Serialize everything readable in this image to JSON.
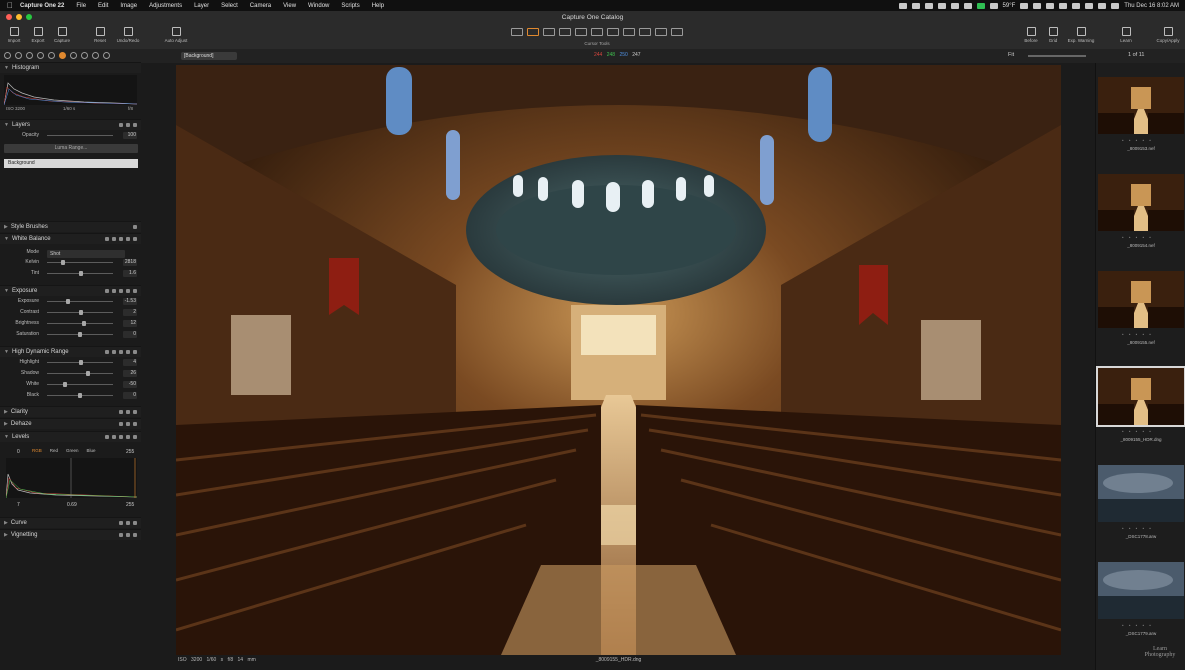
{
  "menubar": {
    "app_name": "Capture One 22",
    "items": [
      "File",
      "Edit",
      "Image",
      "Adjustments",
      "Layer",
      "Select",
      "Camera",
      "View",
      "Window",
      "Scripts",
      "Help"
    ],
    "temperature": "59°F",
    "datetime": "Thu Dec 16  8:02 AM"
  },
  "window": {
    "title": "Capture One Catalog"
  },
  "toolbar": {
    "left_buttons": [
      "Import",
      "Export",
      "Capture",
      "Reset",
      "Undo/Redo",
      "Auto Adjust"
    ],
    "cursor_tools_label": "Cursor Tools",
    "right_buttons": [
      "Before",
      "Grid",
      "Exp. Warning",
      "Learn",
      "Copy/Apply"
    ]
  },
  "subbar": {
    "variant": "[Background]",
    "rgb": {
      "r": "244",
      "g": "248",
      "b": "250",
      "a": "247"
    },
    "fit_label": "Fit",
    "count": "1 of 11"
  },
  "colors": {
    "accent": "#e0892f",
    "rgb_r": "#d6453d",
    "rgb_g": "#3fbf4f",
    "rgb_b": "#4f8fe0"
  },
  "histogram": {
    "title": "Histogram",
    "iso": "ISO 3200",
    "shutter": "1/60 s",
    "aperture": "f/8"
  },
  "layers": {
    "title": "Layers",
    "opacity_label": "Opacity",
    "opacity_value": "100",
    "luma_button": "Luma Range...",
    "background_layer": "Background"
  },
  "style_brushes": {
    "title": "Style Brushes"
  },
  "white_balance": {
    "title": "White Balance",
    "mode_label": "Mode",
    "mode_value": "Shot",
    "rows": [
      {
        "label": "Kelvin",
        "value": "2818",
        "level": 0.22
      },
      {
        "label": "Tint",
        "value": "1.6",
        "level": 0.52
      }
    ]
  },
  "exposure": {
    "title": "Exposure",
    "rows": [
      {
        "label": "Exposure",
        "value": "-1.53",
        "level": 0.3
      },
      {
        "label": "Contrast",
        "value": "2",
        "level": 0.51
      },
      {
        "label": "Brightness",
        "value": "12",
        "level": 0.56
      },
      {
        "label": "Saturation",
        "value": "0",
        "level": 0.5
      }
    ]
  },
  "hdr": {
    "title": "High Dynamic Range",
    "rows": [
      {
        "label": "Highlight",
        "value": "4",
        "level": 0.52
      },
      {
        "label": "Shadow",
        "value": "26",
        "level": 0.63
      },
      {
        "label": "White",
        "value": "-50",
        "level": 0.25
      },
      {
        "label": "Black",
        "value": "0",
        "level": 0.5
      }
    ]
  },
  "clarity": {
    "title": "Clarity"
  },
  "dehaze": {
    "title": "Dehaze"
  },
  "levels": {
    "title": "Levels",
    "low": "0",
    "high": "255",
    "channels": [
      "RGB",
      "Red",
      "Green",
      "Blue"
    ],
    "input_low": "7",
    "gamma": "0.69",
    "input_high": "255"
  },
  "curve": {
    "title": "Curve"
  },
  "vignetting": {
    "title": "Vignetting"
  },
  "viewer": {
    "meta": [
      "ISO 3200",
      "1/60 s",
      "f/8",
      "14 mm"
    ],
    "filename": "_8009155_HDR.dng"
  },
  "browser": {
    "thumbnails": [
      {
        "name": "_8009153.nef",
        "kind": "church"
      },
      {
        "name": "_8009154.nef",
        "kind": "church"
      },
      {
        "name": "_8009155.nef",
        "kind": "church"
      },
      {
        "name": "_8009155_HDR.dng",
        "kind": "church",
        "selected": true
      },
      {
        "name": "_DSC1778.arw",
        "kind": "sky"
      },
      {
        "name": "_DSC1779.arw",
        "kind": "sky"
      }
    ],
    "stars": "• • • • •"
  },
  "watermark": {
    "line1": "Learn",
    "line2": "Photography"
  }
}
